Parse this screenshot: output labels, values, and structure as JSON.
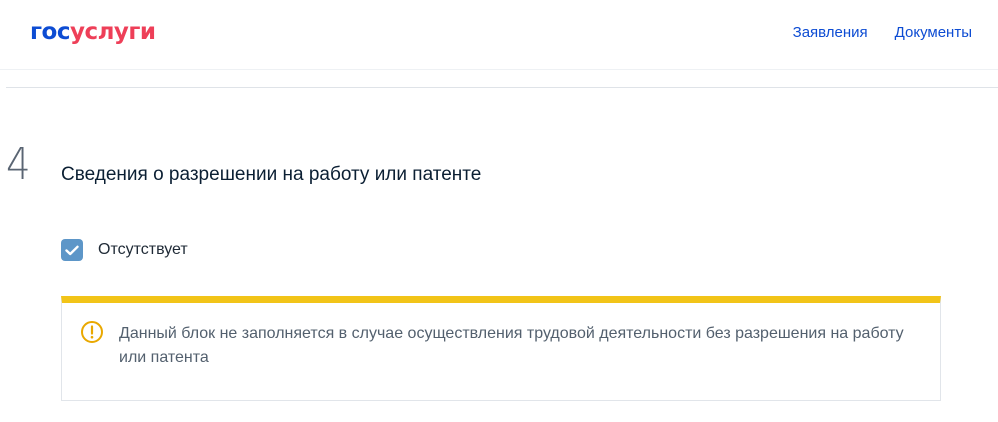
{
  "header": {
    "logo_part1": "гос",
    "logo_part2": "услуги",
    "nav": {
      "applications": "Заявления",
      "documents": "Документы"
    }
  },
  "step": {
    "number": "4",
    "title": "Сведения о разрешении на работу или патенте"
  },
  "absent_checkbox": {
    "label": "Отсутствует",
    "checked": true
  },
  "notice": {
    "text": "Данный блок не заполняется в случае осуществления трудовой деятельности без разрешения на работу или патента",
    "icon": "warning-circle-icon"
  },
  "colors": {
    "brand_blue": "#0d4cd3",
    "brand_red": "#ee3f58",
    "checkbox": "#5d96c8",
    "notice_accent": "#f2c418",
    "warning_icon": "#e9a800"
  }
}
